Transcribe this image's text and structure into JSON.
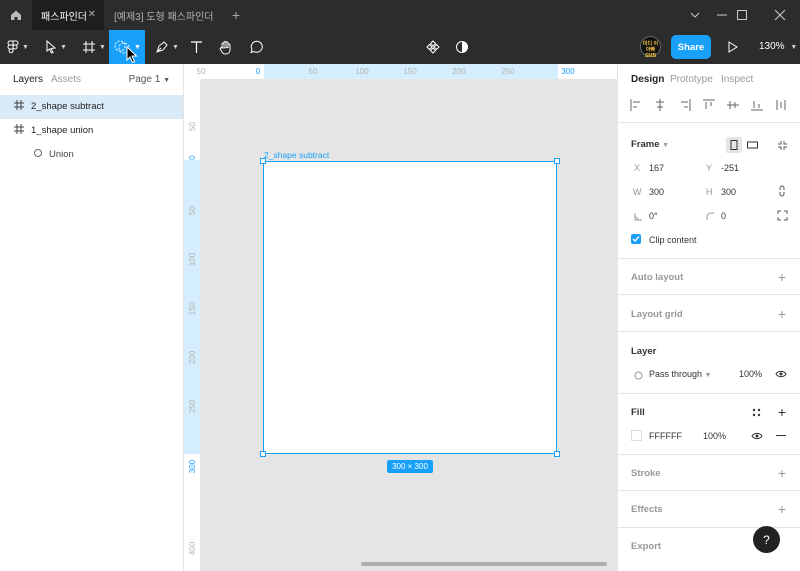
{
  "titlebar": {
    "tabs": [
      {
        "label": "패스파인더",
        "active": true
      },
      {
        "label": "[예제3] 도형 패스파인더",
        "active": false
      }
    ],
    "new_tab": "+"
  },
  "toolbar": {
    "zoom": "130%",
    "share_label": "Share",
    "avatar_text": "미디 이 아빠 SMB"
  },
  "left_panel": {
    "tabs": [
      "Layers",
      "Assets"
    ],
    "page_label": "Page 1",
    "layers": [
      {
        "name": "2_shape subtract",
        "icon": "frame-icon",
        "selected": true
      },
      {
        "name": "1_shape union",
        "icon": "frame-icon",
        "selected": false
      },
      {
        "name": "Union",
        "icon": "boolean-union-icon",
        "selected": false
      }
    ]
  },
  "canvas": {
    "frame_name": "2_shape subtract",
    "size_badge": "300 × 300",
    "ruler_top": [
      "50",
      "0",
      "50",
      "100",
      "150",
      "200",
      "250",
      "300"
    ],
    "ruler_left": [
      "50",
      "0",
      "50",
      "100",
      "150",
      "200",
      "250",
      "300",
      "400"
    ]
  },
  "right_panel": {
    "tabs": [
      "Design",
      "Prototype",
      "Inspect"
    ],
    "frame_title": "Frame",
    "x_label": "X",
    "x_value": "167",
    "y_label": "Y",
    "y_value": "-251",
    "w_label": "W",
    "w_value": "300",
    "h_label": "H",
    "h_value": "300",
    "rotation": "0°",
    "radius": "0",
    "clip_content": "Clip content",
    "auto_layout": "Auto layout",
    "layout_grid": "Layout grid",
    "layer_title": "Layer",
    "blend_mode": "Pass through",
    "layer_opacity": "100%",
    "fill_title": "Fill",
    "fill_hex": "FFFFFF",
    "fill_opacity": "100%",
    "stroke": "Stroke",
    "effects": "Effects",
    "export": "Export",
    "help": "?"
  },
  "colors": {
    "accent": "#18a0fb",
    "chrome": "#2c2c2c",
    "canvas_bg": "#e5e5e5"
  }
}
